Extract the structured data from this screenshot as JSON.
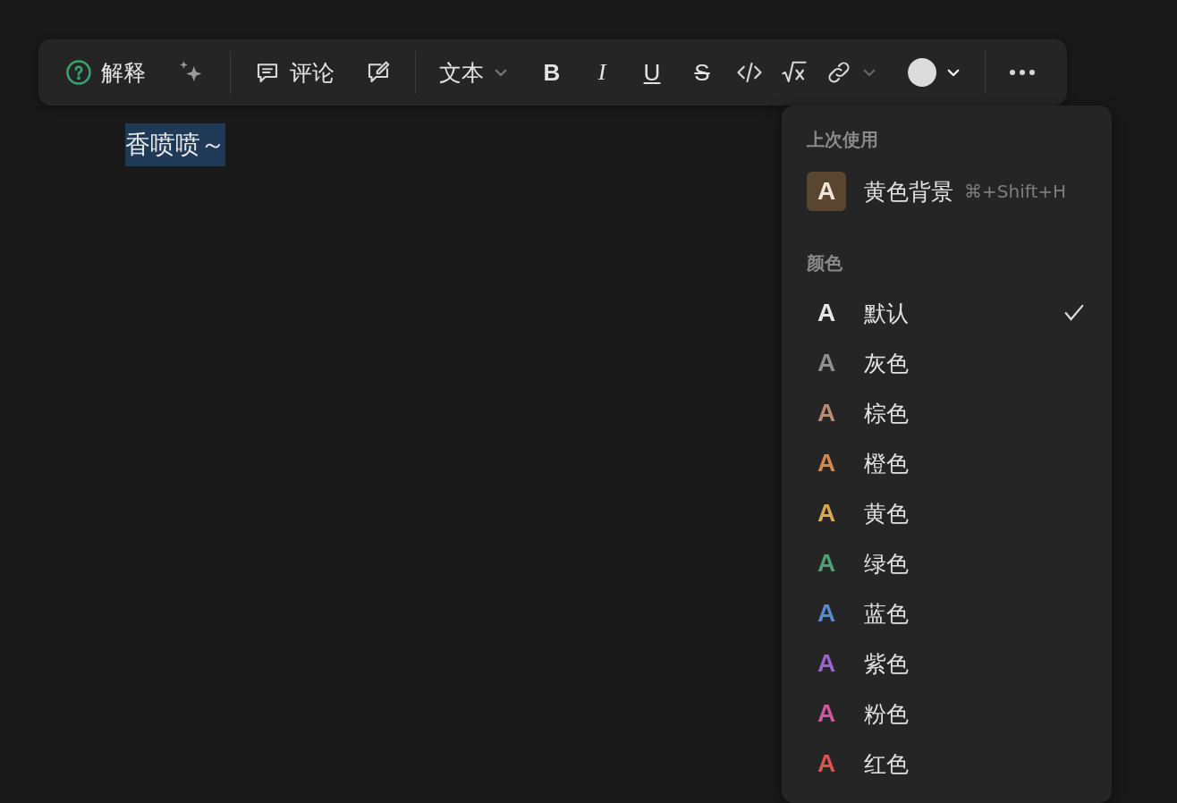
{
  "toolbar": {
    "explain": "解释",
    "comment": "评论",
    "block_type": "文本",
    "format_buttons": [
      {
        "kind": "bold",
        "label": "B"
      },
      {
        "kind": "italic",
        "label": "I"
      },
      {
        "kind": "underline",
        "label": "U"
      },
      {
        "kind": "strike",
        "label": "S"
      }
    ]
  },
  "editor": {
    "selected_text": "香喷喷～"
  },
  "color_menu": {
    "recent_heading": "上次使用",
    "recent": {
      "glyph": "A",
      "label": "黄色背景",
      "shortcut": "⌘+Shift+H",
      "color": "#5a4630"
    },
    "colors_heading": "颜色",
    "colors": [
      {
        "glyph": "A",
        "label": "默认",
        "color": "#e6e6e6",
        "selected": true
      },
      {
        "glyph": "A",
        "label": "灰色",
        "color": "#8f8f8f",
        "selected": false
      },
      {
        "glyph": "A",
        "label": "棕色",
        "color": "#b98a72",
        "selected": false
      },
      {
        "glyph": "A",
        "label": "橙色",
        "color": "#d58848",
        "selected": false
      },
      {
        "glyph": "A",
        "label": "黄色",
        "color": "#d9a84e",
        "selected": false
      },
      {
        "glyph": "A",
        "label": "绿色",
        "color": "#4e9f73",
        "selected": false
      },
      {
        "glyph": "A",
        "label": "蓝色",
        "color": "#5a88d2",
        "selected": false
      },
      {
        "glyph": "A",
        "label": "紫色",
        "color": "#9b63d1",
        "selected": false
      },
      {
        "glyph": "A",
        "label": "粉色",
        "color": "#d0589a",
        "selected": false
      },
      {
        "glyph": "A",
        "label": "红色",
        "color": "#d9534f",
        "selected": false
      }
    ]
  }
}
